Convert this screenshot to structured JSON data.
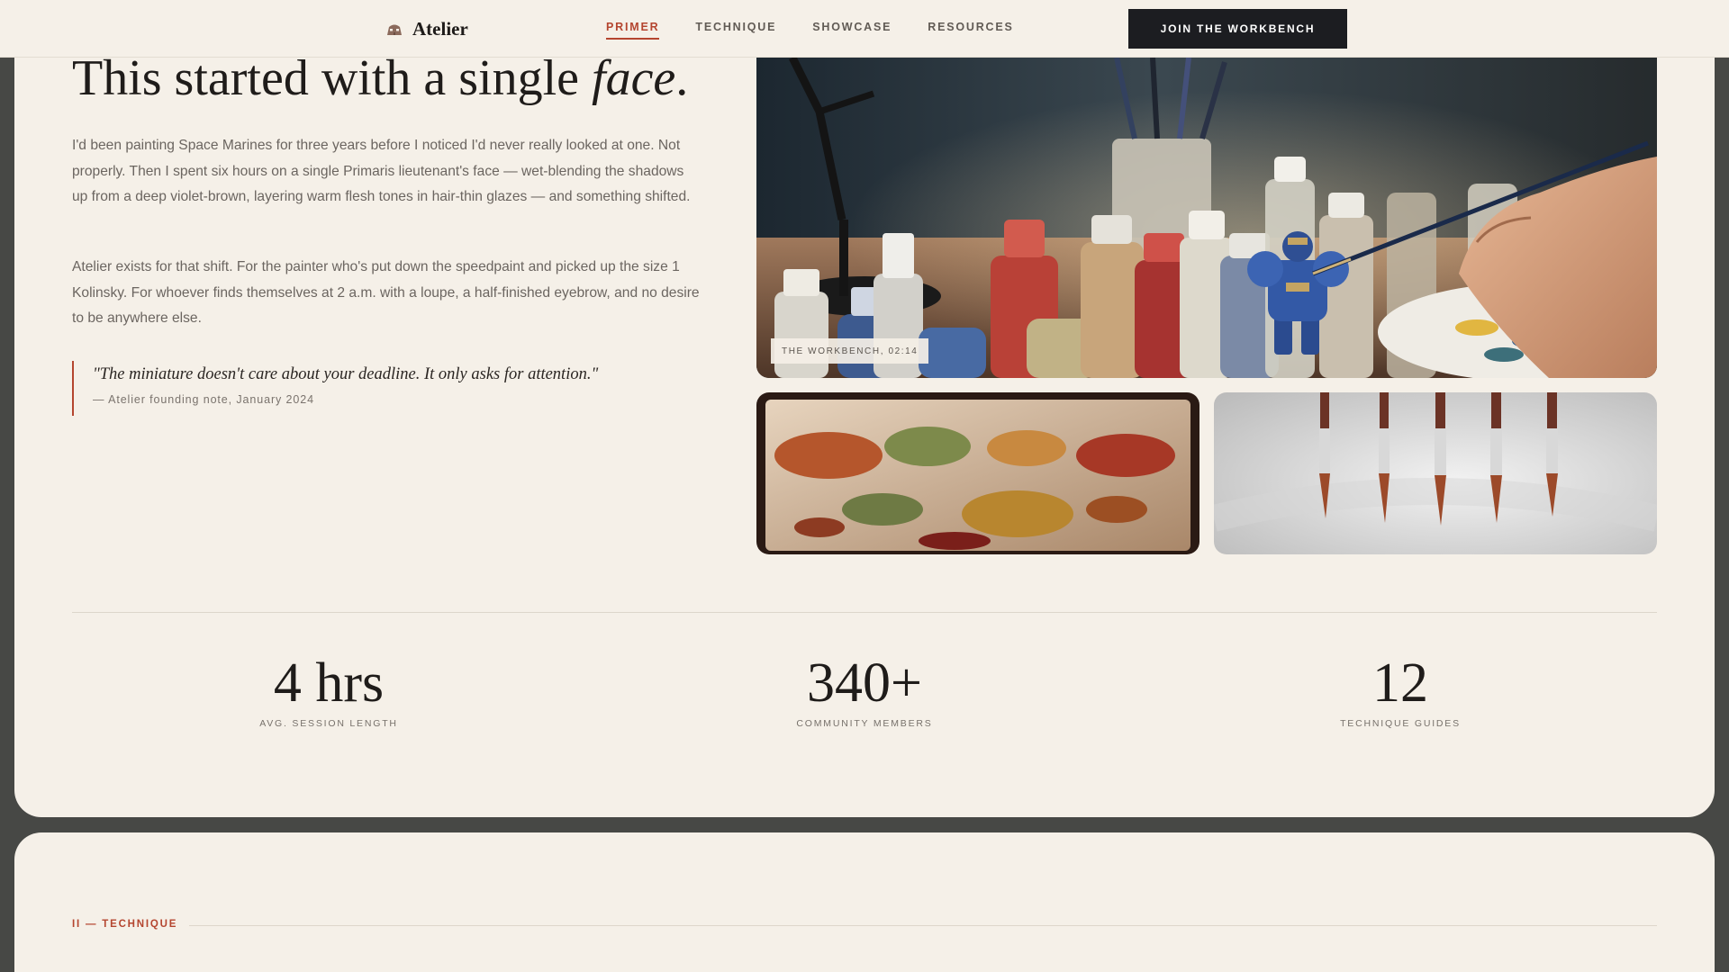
{
  "header": {
    "brand": "Atelier",
    "nav": [
      {
        "label": "PRIMER",
        "active": true
      },
      {
        "label": "TECHNIQUE",
        "active": false
      },
      {
        "label": "SHOWCASE",
        "active": false
      },
      {
        "label": "RESOURCES",
        "active": false
      }
    ],
    "cta_label": "JOIN THE WORKBENCH"
  },
  "hero": {
    "headline_lead": "This started with a single ",
    "headline_emphasis": "face",
    "headline_tail": ".",
    "paragraphs": [
      "I'd been painting Space Marines for three years before I noticed I'd never really looked at one. Not properly. Then I spent six hours on a single Primaris lieutenant's face — wet-blending the shadows up from a deep violet-brown, layering warm flesh tones in hair-thin glazes — and something shifted.",
      "Atelier exists for that shift. For the painter who's put down the speedpaint and picked up the size 1 Kolinsky. For whoever finds themselves at 2 a.m. with a loupe, a half-finished eyebrow, and no desire to be anywhere else."
    ],
    "quote": {
      "text": "\"The miniature doesn't care about your deadline. It only asks for attention.\"",
      "cite": "— Atelier founding note, January 2024"
    }
  },
  "gallery": {
    "main_caption": "THE WORKBENCH, 02:14",
    "main_alt": "painter's hand brushing a blue space marine miniature among paint pots",
    "paint_alt": "wet palette with blobs of red, green and ochre paint",
    "brush_alt": "row of fine sable brushes on white background"
  },
  "stats": [
    {
      "value": "4 hrs",
      "label": "AVG. SESSION LENGTH"
    },
    {
      "value": "340+",
      "label": "COMMUNITY MEMBERS"
    },
    {
      "value": "12",
      "label": "TECHNIQUE GUIDES"
    }
  ],
  "next_section": {
    "label": "II — TECHNIQUE"
  },
  "colors": {
    "accent": "#b4452f",
    "cream": "#f5f0e8",
    "ink": "#1f1c1a",
    "frame": "#474845",
    "cta_bg": "#1c1d21"
  }
}
